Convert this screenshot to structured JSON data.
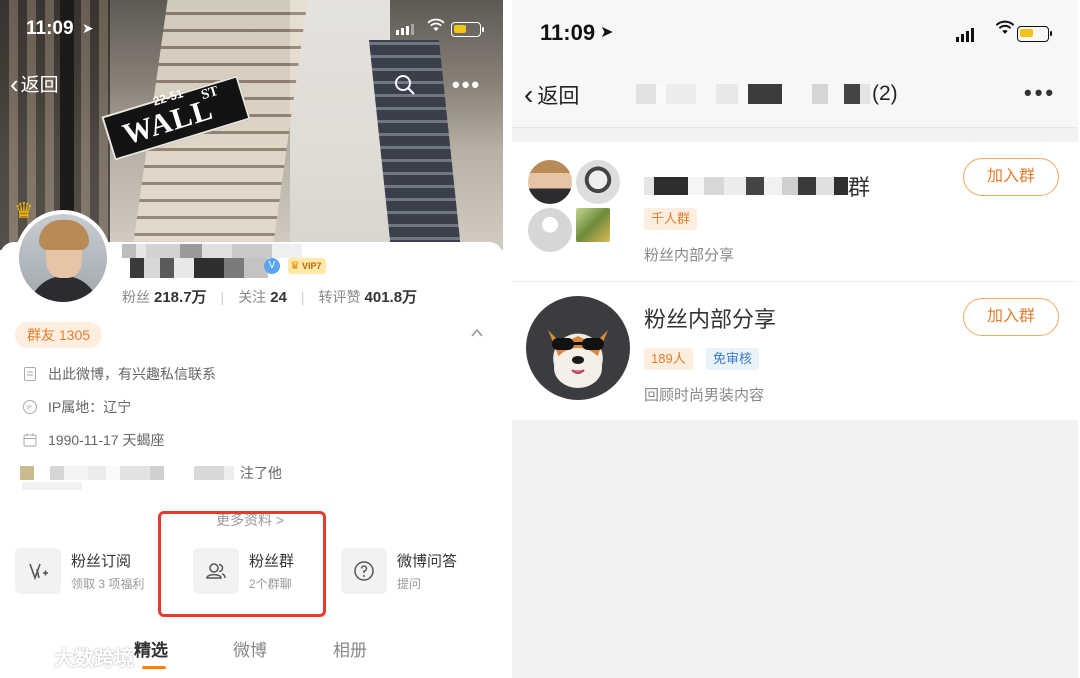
{
  "left_screen": {
    "status_bar": {
      "time": "11:09"
    },
    "nav": {
      "back_label": "返回"
    },
    "banner": {
      "sign_number": "22-51",
      "sign_name": "WALL",
      "sign_suffix": "ST"
    },
    "profile": {
      "vip_label": "VIP7",
      "stats": [
        {
          "label": "粉丝",
          "value": "218.7万"
        },
        {
          "label": "关注",
          "value": "24"
        },
        {
          "label": "转评赞",
          "value": "401.8万"
        }
      ],
      "group_friends_badge": "群友 1305",
      "bio": "出此微博，有兴趣私信联系",
      "ip_location": "IP属地：辽宁",
      "birthday": "1990-11-17 天蝎座",
      "followed_suffix": "注了他",
      "more_info": "更多资料 >"
    },
    "entries": [
      {
        "title": "粉丝订阅",
        "subtitle": "领取 3 项福利"
      },
      {
        "title": "粉丝群",
        "subtitle": "2个群聊"
      },
      {
        "title": "微博问答",
        "subtitle": "提问"
      }
    ],
    "tabs": [
      "精选",
      "微博",
      "相册"
    ],
    "active_tab": "精选",
    "watermark": "大数跨境"
  },
  "right_screen": {
    "status_bar": {
      "time": "11:09"
    },
    "nav": {
      "back_label": "返回",
      "title_count": "(2)"
    },
    "groups": [
      {
        "name_tail": "群",
        "tag": "千人群",
        "description": "粉丝内部分享",
        "join_label": "加入群"
      },
      {
        "name": "粉丝内部分享",
        "tags": [
          "189人",
          "免审核"
        ],
        "description": "回顾时尚男装内容",
        "join_label": "加入群"
      }
    ]
  },
  "colors": {
    "accent_orange": "#ff8200",
    "highlight_red": "#e53b2e",
    "tag_orange": "#e57d2b",
    "tag_blue": "#3d7cc9"
  }
}
